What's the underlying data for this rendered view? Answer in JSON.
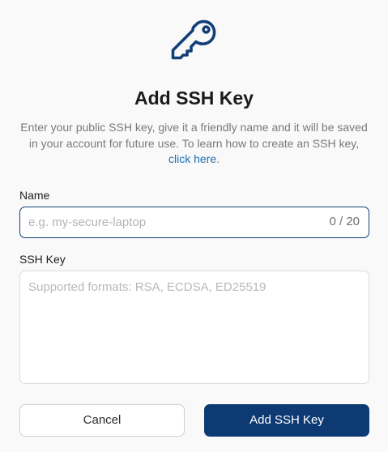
{
  "dialog": {
    "icon": "key-icon",
    "title": "Add SSH Key",
    "description_text": "Enter your public SSH key, give it a friendly name and it will be saved in your account for future use. To learn how to create an SSH key, ",
    "description_link": "click here",
    "description_end": "."
  },
  "name_field": {
    "label": "Name",
    "placeholder": "e.g. my-secure-laptop",
    "value": "",
    "counter": "0 / 20"
  },
  "ssh_field": {
    "label": "SSH Key",
    "placeholder": "Supported formats: RSA, ECDSA, ED25519",
    "value": ""
  },
  "buttons": {
    "cancel": "Cancel",
    "add": "Add SSH Key"
  },
  "colors": {
    "primary": "#0e3a74",
    "link": "#1a6fb5",
    "focus_border": "#123f78"
  }
}
